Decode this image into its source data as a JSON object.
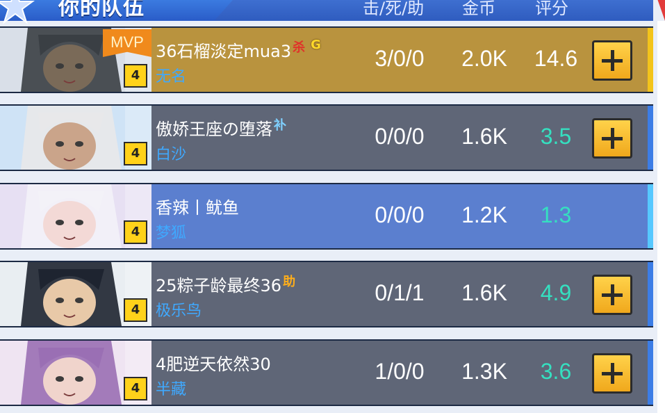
{
  "header": {
    "title": "你的队伍",
    "col_kda": "击/死/助",
    "col_gold": "金币",
    "col_score": "评分"
  },
  "colors": {
    "mvp_row": "#b9933e",
    "row_dark": "#5f6677",
    "row_self": "#5b7fcf",
    "score_green": "#35e0c0",
    "accent_gold": "#f3c41b",
    "accent_blue": "#3c7de6"
  },
  "players": [
    {
      "name": "36石榴淡定mua3",
      "tags": [
        {
          "text": "杀",
          "kind": "kill"
        },
        {
          "text": "G",
          "kind": "g"
        }
      ],
      "hero": "无名",
      "level": "4",
      "mvp": "MVP",
      "kda": "3/0/0",
      "gold": "2.0K",
      "score": "14.6",
      "has_plus": true
    },
    {
      "name": "傲娇王座の堕落",
      "tags": [
        {
          "text": "补",
          "kind": "sup"
        }
      ],
      "hero": "白沙",
      "level": "4",
      "kda": "0/0/0",
      "gold": "1.6K",
      "score": "3.5",
      "has_plus": true
    },
    {
      "name": "香辣丨鱿鱼",
      "tags": [],
      "hero": "梦狐",
      "level": "4",
      "kda": "0/0/0",
      "gold": "1.2K",
      "score": "1.3",
      "has_plus": false
    },
    {
      "name": "25粽子龄最终36",
      "tags": [
        {
          "text": "助",
          "kind": "ast"
        }
      ],
      "hero": "极乐鸟",
      "level": "4",
      "kda": "0/1/1",
      "gold": "1.6K",
      "score": "4.9",
      "has_plus": true
    },
    {
      "name": "4肥逆天依然30",
      "tags": [],
      "hero": "半藏",
      "level": "4",
      "kda": "1/0/0",
      "gold": "1.3K",
      "score": "3.6",
      "has_plus": true
    }
  ]
}
